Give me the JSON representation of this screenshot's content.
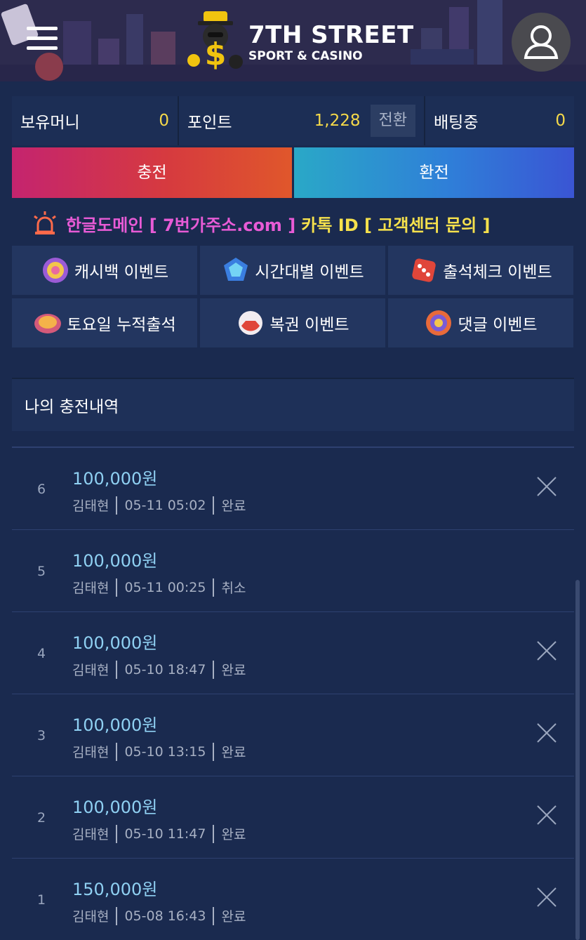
{
  "header": {
    "logo_title": "7TH STREET",
    "logo_subtitle": "SPORT & CASINO",
    "menu_icon": "hamburger-icon",
    "user_icon": "user-icon"
  },
  "balance": {
    "money_label": "보유머니",
    "money_value": "0",
    "point_label": "포인트",
    "point_value": "1,228",
    "convert_label": "전환",
    "betting_label": "배팅중",
    "betting_value": "0"
  },
  "actions": {
    "charge_label": "충전",
    "exchange_label": "환전"
  },
  "notice": {
    "icon": "alarm-siren-icon",
    "domain_text": "한글도메인 [ 7번가주소.com ]",
    "kakao_text": "카톡 ID [ 고객센터 문의 ]"
  },
  "events": [
    {
      "label": "캐시백 이벤트",
      "icon": "cashback-icon"
    },
    {
      "label": "시간대별 이벤트",
      "icon": "gem-icon"
    },
    {
      "label": "출석체크 이벤트",
      "icon": "dice-icon"
    },
    {
      "label": "토요일 누적출석",
      "icon": "chip-icon"
    },
    {
      "label": "복권 이벤트",
      "icon": "ball-icon"
    },
    {
      "label": "댓글 이벤트",
      "icon": "wheel-icon"
    }
  ],
  "section": {
    "title": "나의 충전내역"
  },
  "history": [
    {
      "num": "6",
      "amount": "100,000원",
      "name": "김태현",
      "date": "05-11 05:02",
      "status": "완료",
      "deletable": true
    },
    {
      "num": "5",
      "amount": "100,000원",
      "name": "김태현",
      "date": "05-11 00:25",
      "status": "취소",
      "deletable": false
    },
    {
      "num": "4",
      "amount": "100,000원",
      "name": "김태현",
      "date": "05-10 18:47",
      "status": "완료",
      "deletable": true
    },
    {
      "num": "3",
      "amount": "100,000원",
      "name": "김태현",
      "date": "05-10 13:15",
      "status": "완료",
      "deletable": true
    },
    {
      "num": "2",
      "amount": "100,000원",
      "name": "김태현",
      "date": "05-10 11:47",
      "status": "완료",
      "deletable": true
    },
    {
      "num": "1",
      "amount": "150,000원",
      "name": "김태현",
      "date": "05-08 16:43",
      "status": "완료",
      "deletable": true
    }
  ],
  "colors": {
    "background": "#1a2a4f",
    "money_value": "#f5d94a",
    "amount": "#8fd0f2",
    "domain_text": "#e85bd6",
    "kakao_text": "#f6e14c"
  }
}
